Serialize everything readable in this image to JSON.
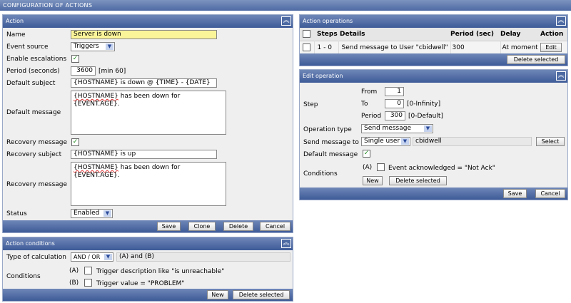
{
  "title": "CONFIGURATION OF ACTIONS",
  "action": {
    "header": "Action",
    "name_label": "Name",
    "name_value": "Server is down",
    "event_source_label": "Event source",
    "event_source_value": "Triggers",
    "escalations_label": "Enable escalations",
    "period_label": "Period (seconds)",
    "period_value": "3600",
    "period_hint": "[min 60]",
    "def_subject_label": "Default subject",
    "def_subject_value": "{HOSTNAME} is down @ {TIME} - {DATE}",
    "def_msg_label": "Default message",
    "def_msg_host": "{HOSTNAME}",
    "def_msg_rest": " has been down for {EVENT.AGE}.",
    "rec_msg_check_label": "Recovery message",
    "rec_subject_label": "Recovery subject",
    "rec_subject_value": "{HOSTNAME} is up",
    "rec_msg_label": "Recovery message",
    "rec_msg_host": "{HOSTNAME}",
    "rec_msg_rest": " has been down for {EVENT.AGE}.",
    "status_label": "Status",
    "status_value": "Enabled",
    "buttons": {
      "save": "Save",
      "clone": "Clone",
      "delete": "Delete",
      "cancel": "Cancel"
    }
  },
  "conditions": {
    "header": "Action conditions",
    "calc_label": "Type of calculation",
    "calc_value": "AND / OR",
    "calc_expr": "(A) and (B)",
    "cond_label": "Conditions",
    "items": [
      {
        "tag": "(A)",
        "text": "Trigger description like \"is unreachable\""
      },
      {
        "tag": "(B)",
        "text": "Trigger value = \"PROBLEM\""
      }
    ],
    "new": "New",
    "delete_selected": "Delete selected"
  },
  "operations": {
    "header": "Action operations",
    "columns": [
      "Steps",
      "Details",
      "Period (sec)",
      "Delay",
      "Action"
    ],
    "rows": [
      {
        "steps": "1 - 0",
        "details": "Send message to User \"cbidwell\"",
        "period": "300",
        "delay": "At moment",
        "action": "Edit"
      }
    ],
    "delete_selected": "Delete selected"
  },
  "edit": {
    "header": "Edit operation",
    "step_label": "Step",
    "from_label": "From",
    "from_value": "1",
    "to_label": "To",
    "to_value": "0",
    "to_hint": "[0-Infinity]",
    "period_label": "Period",
    "period_value": "300",
    "period_hint": "[0-Default]",
    "optype_label": "Operation type",
    "optype_value": "Send message",
    "sendto_label": "Send message to",
    "sendto_value": "Single user",
    "user_value": "cbidwell",
    "select": "Select",
    "defmsg_label": "Default message",
    "cond_label": "Conditions",
    "cond_tag": "(A)",
    "cond_text": "Event acknowledged = \"Not Ack\"",
    "new": "New",
    "delete_selected": "Delete selected",
    "save": "Save",
    "cancel": "Cancel"
  }
}
